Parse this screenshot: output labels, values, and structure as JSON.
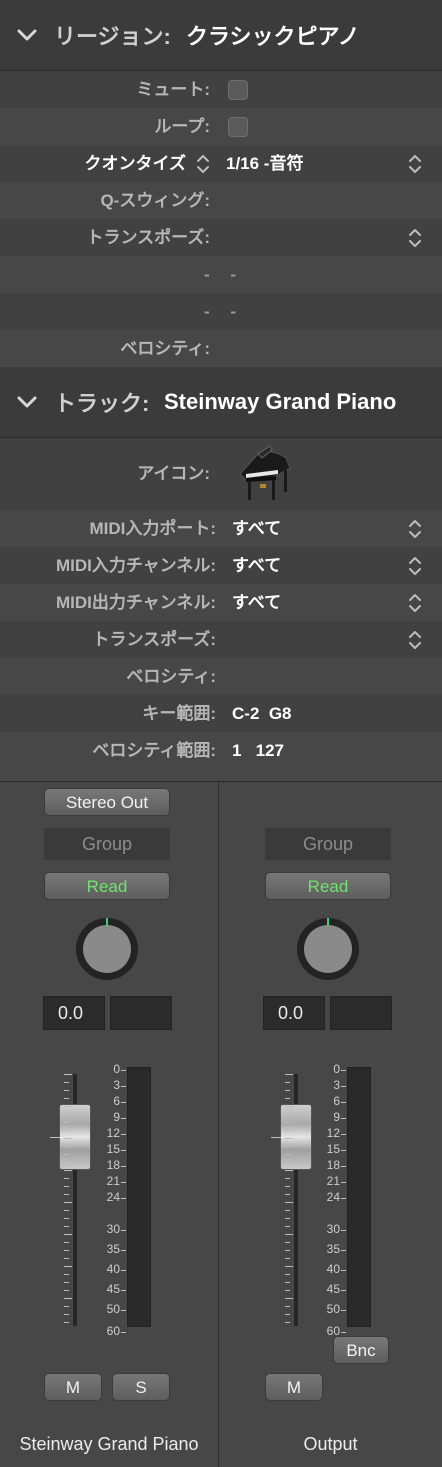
{
  "region": {
    "header_label": "リージョン:",
    "header_value": "クラシックピアノ",
    "mute_label": "ミュート:",
    "loop_label": "ループ:",
    "quantize_label": "クオンタイズ",
    "quantize_value": "1/16 -音符",
    "qswing_label": "Q-スウィング:",
    "transpose_label": "トランスポーズ:",
    "dash1": "- -",
    "dash2": "- -",
    "velocity_label": "ベロシティ:"
  },
  "track": {
    "header_label": "トラック:",
    "header_value": "Steinway Grand Piano",
    "icon_label": "アイコン:",
    "midi_in_port_label": "MIDI入力ポート:",
    "midi_in_port_value": "すべて",
    "midi_in_channel_label": "MIDI入力チャンネル:",
    "midi_in_channel_value": "すべて",
    "midi_out_channel_label": "MIDI出力チャンネル:",
    "midi_out_channel_value": "すべて",
    "transpose_label": "トランスポーズ:",
    "velocity_label": "ベロシティ:",
    "key_range_label": "キー範囲:",
    "key_range_value": "C-2  G8",
    "velocity_range_label": "ベロシティ範囲:",
    "velocity_range_value": "1   127"
  },
  "mixer": {
    "left": {
      "output_button": "Stereo Out",
      "group": "Group",
      "automation": "Read",
      "volume_value": "0.0",
      "mute": "M",
      "solo": "S",
      "name": "Steinway Grand Piano"
    },
    "right": {
      "group": "Group",
      "automation": "Read",
      "volume_value": "0.0",
      "bounce": "Bnc",
      "mute": "M",
      "name": "Output"
    },
    "meter_scale": [
      "0",
      "3",
      "6",
      "9",
      "12",
      "15",
      "18",
      "21",
      "24",
      "30",
      "35",
      "40",
      "45",
      "50",
      "60"
    ]
  },
  "colors": {
    "read_green": "#6ee36e",
    "panel_bg": "#474747",
    "header_bg": "#3b3b3b"
  }
}
